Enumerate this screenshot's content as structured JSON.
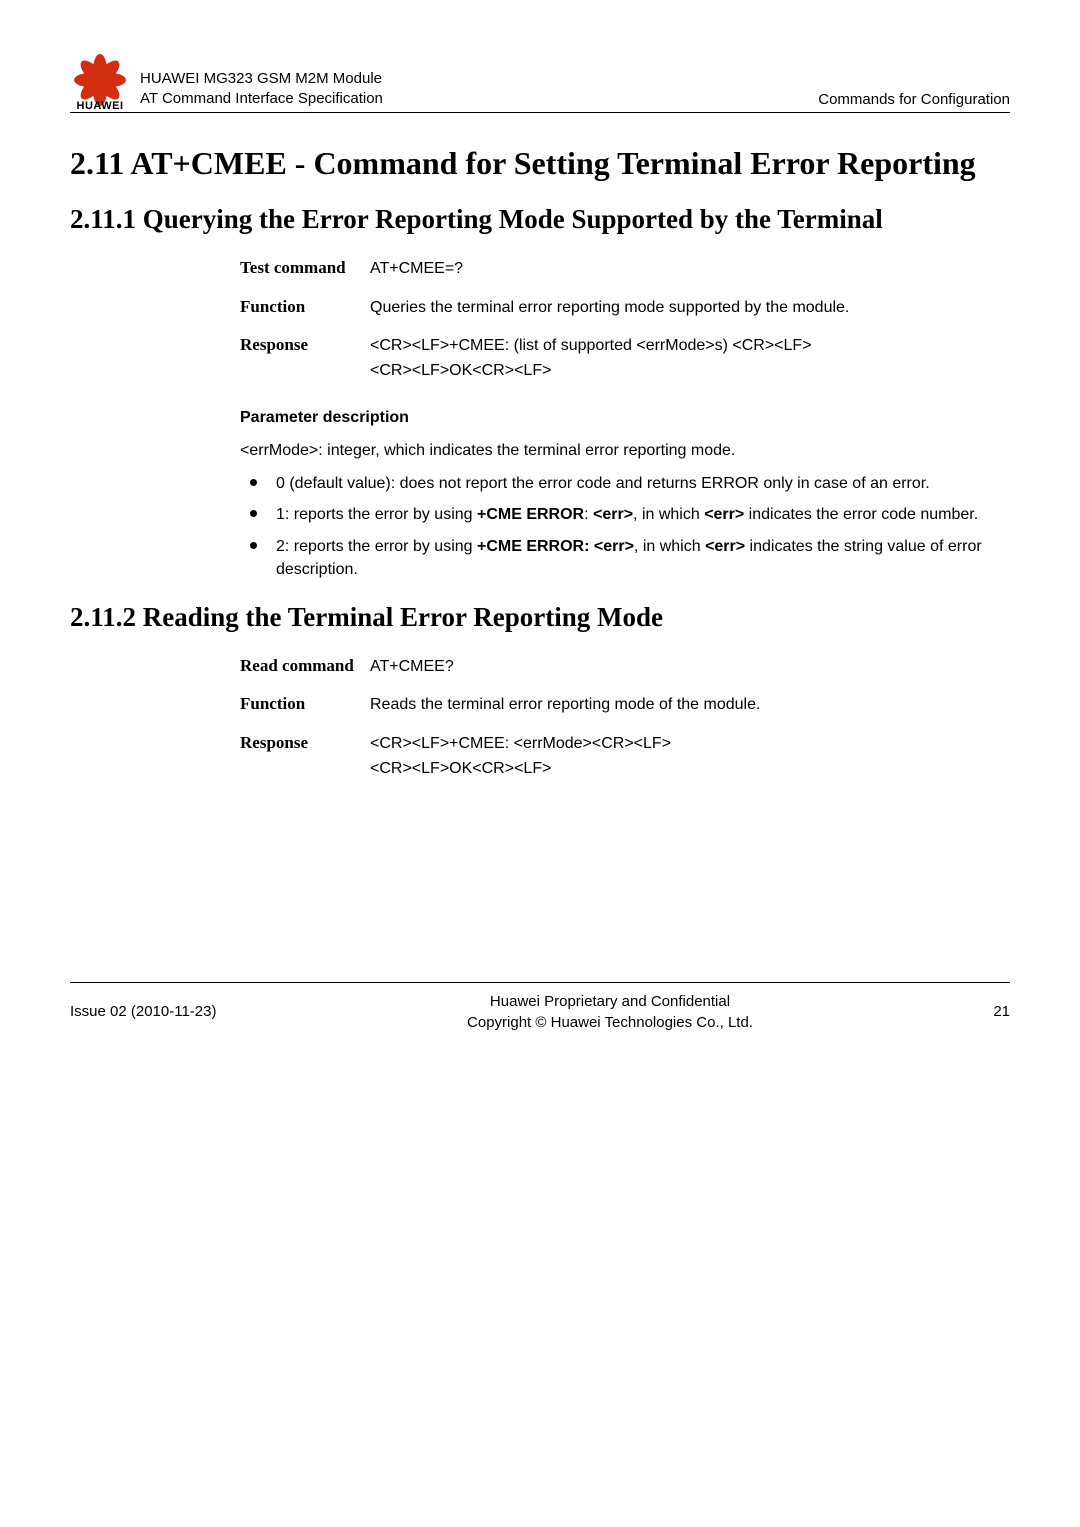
{
  "header": {
    "module": "HUAWEI MG323 GSM M2M Module",
    "spec": "AT Command Interface Specification",
    "right": "Commands for Configuration",
    "brand": "HUAWEI"
  },
  "section_h1": "2.11 AT+CMEE - Command for Setting Terminal Error Reporting",
  "section_h2_1": "2.11.1 Querying the Error Reporting Mode Supported by the Terminal",
  "table1": {
    "test_label": "Test command",
    "test_value": "AT+CMEE=?",
    "func_label": "Function",
    "func_value": "Queries the terminal error reporting mode supported by the module.",
    "resp_label": "Response",
    "resp_line1": "<CR><LF>+CMEE: (list of supported <errMode>s) <CR><LF>",
    "resp_line2": " <CR><LF>OK<CR><LF>"
  },
  "param_heading": "Parameter description",
  "param_intro": "<errMode>: integer, which indicates the terminal error reporting mode.",
  "bullets": {
    "b1": "0 (default value): does not report the error code and returns ERROR only in case of an error.",
    "b2_pre": "1: reports the error by using ",
    "b2_bold1": "+CME ERROR",
    "b2_mid": ": ",
    "b2_bold2": "<err>",
    "b2_mid2": ", in which ",
    "b2_bold3": "<err>",
    "b2_post": " indicates the error code number.",
    "b3_pre": "2: reports the error by using ",
    "b3_bold1": "+CME ERROR: <err>",
    "b3_mid": ", in which ",
    "b3_bold2": "<err>",
    "b3_post": " indicates the string value of error description."
  },
  "section_h2_2": "2.11.2 Reading the Terminal Error Reporting Mode",
  "table2": {
    "read_label": "Read command",
    "read_value": "AT+CMEE?",
    "func_label": "Function",
    "func_value": "Reads the terminal error reporting mode of the module.",
    "resp_label": "Response",
    "resp_line1": "<CR><LF>+CMEE: <errMode><CR><LF>",
    "resp_line2": " <CR><LF>OK<CR><LF>"
  },
  "footer": {
    "left": "Issue 02 (2010-11-23)",
    "center1": "Huawei Proprietary and Confidential",
    "center2": "Copyright © Huawei Technologies Co., Ltd.",
    "right": "21"
  }
}
